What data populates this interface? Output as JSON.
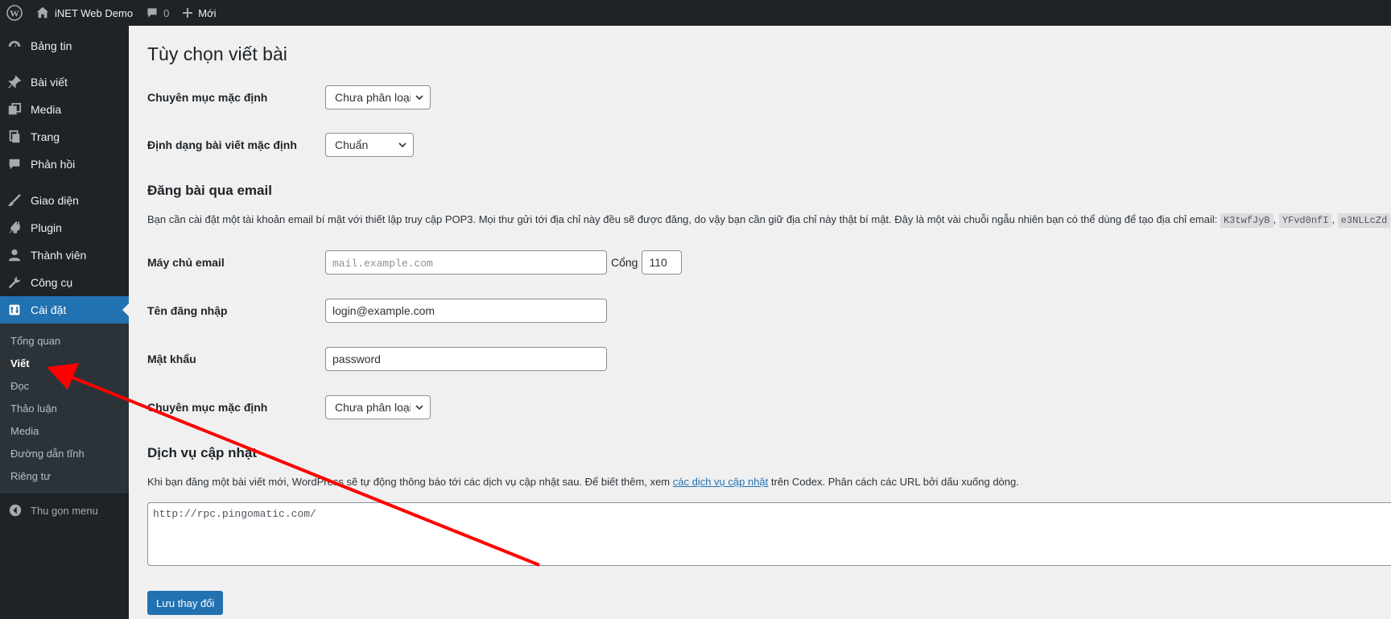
{
  "adminbar": {
    "site_name": "iNET Web Demo",
    "comments_count": "0",
    "new_label": "Mới"
  },
  "sidebar": {
    "items": [
      {
        "label": "Bảng tin",
        "icon": "dashboard-icon"
      },
      {
        "label": "Bài viết",
        "icon": "pin-icon"
      },
      {
        "label": "Media",
        "icon": "media-icon"
      },
      {
        "label": "Trang",
        "icon": "page-icon"
      },
      {
        "label": "Phản hồi",
        "icon": "comment-icon"
      },
      {
        "label": "Giao diện",
        "icon": "brush-icon"
      },
      {
        "label": "Plugin",
        "icon": "plugin-icon"
      },
      {
        "label": "Thành viên",
        "icon": "user-icon"
      },
      {
        "label": "Công cụ",
        "icon": "wrench-icon"
      },
      {
        "label": "Cài đặt",
        "icon": "settings-icon"
      }
    ],
    "submenu": [
      "Tổng quan",
      "Viết",
      "Đọc",
      "Thảo luận",
      "Media",
      "Đường dẫn tĩnh",
      "Riêng tư"
    ],
    "collapse_label": "Thu gọn menu"
  },
  "page": {
    "title": "Tùy chọn viết bài",
    "default_category_label": "Chuyên mục mặc định",
    "default_category_value": "Chưa phân loại",
    "default_format_label": "Định dạng bài viết mặc định",
    "default_format_value": "Chuẩn",
    "email_section_title": "Đăng bài qua email",
    "email_desc": "Bạn cần cài đặt một tài khoản email bí mật với thiết lập truy cập POP3. Mọi thư gửi tới địa chỉ này đều sẽ được đăng, do vậy bạn cần giữ địa chỉ này thật bí mật. Đây là một vài chuỗi ngẫu nhiên bạn có thể dùng để tạo địa chỉ email:",
    "random_codes": [
      "K3twfJyB",
      "YFvd0nfI",
      "e3NLLcZd"
    ],
    "mail_server_label": "Máy chủ email",
    "mail_server_placeholder": "mail.example.com",
    "port_label": "Cổng",
    "port_value": "110",
    "login_label": "Tên đăng nhập",
    "login_value": "login@example.com",
    "password_label": "Mật khẩu",
    "password_value": "password",
    "mail_category_label": "Chuyên mục mặc định",
    "mail_category_value": "Chưa phân loại",
    "update_section_title": "Dịch vụ cập nhật",
    "update_desc_before": "Khi bạn đăng một bài viết mới, WordPress sẽ tự động thông báo tới các dịch vụ cập nhật sau. Để biết thêm, xem ",
    "update_link": "các dịch vụ cập nhật",
    "update_desc_after": " trên Codex. Phân cách các URL bởi dấu xuống dòng.",
    "ping_sites": "http://rpc.pingomatic.com/",
    "save_label": "Lưu thay đổi"
  },
  "colors": {
    "adminbar_bg": "#1d2327",
    "accent": "#2271b1",
    "annotation_arrow": "#ff0000"
  }
}
